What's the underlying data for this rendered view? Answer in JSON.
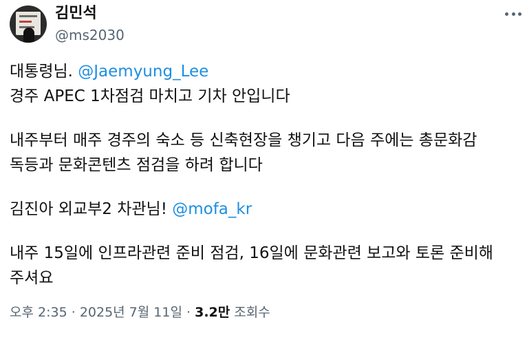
{
  "author": {
    "display_name": "김민석",
    "handle": "@ms2030"
  },
  "tweet": {
    "line1_text": "대통령님.",
    "line1_mention": "@Jaemyung_Lee",
    "line2": "경주 APEC 1차점검 마치고 기차 안입니다",
    "para2_line1": "내주부터 매주 경주의 숙소 등 신축현장을 챙기고 다음 주에는 총문화감",
    "para2_line2": "독등과 문화콘텐츠 점검을 하려 합니다",
    "para3_text": "김진아 외교부2 차관님!",
    "para3_mention": "@mofa_kr",
    "para4_line1": "내주 15일에 인프라관련 준비 점검, 16일에 문화관련 보고와 토론 준비해",
    "para4_line2": "주셔요"
  },
  "meta": {
    "time": "오후 2:35",
    "separator1": "·",
    "date": "2025년 7월 11일",
    "separator2": "·",
    "view_count": "3.2만",
    "view_label": "조회수"
  },
  "icons": {
    "more": "more-horizontal-icon"
  },
  "colors": {
    "mention": "#1d8fe0",
    "secondary_text": "#566572",
    "primary_text": "#111111"
  }
}
